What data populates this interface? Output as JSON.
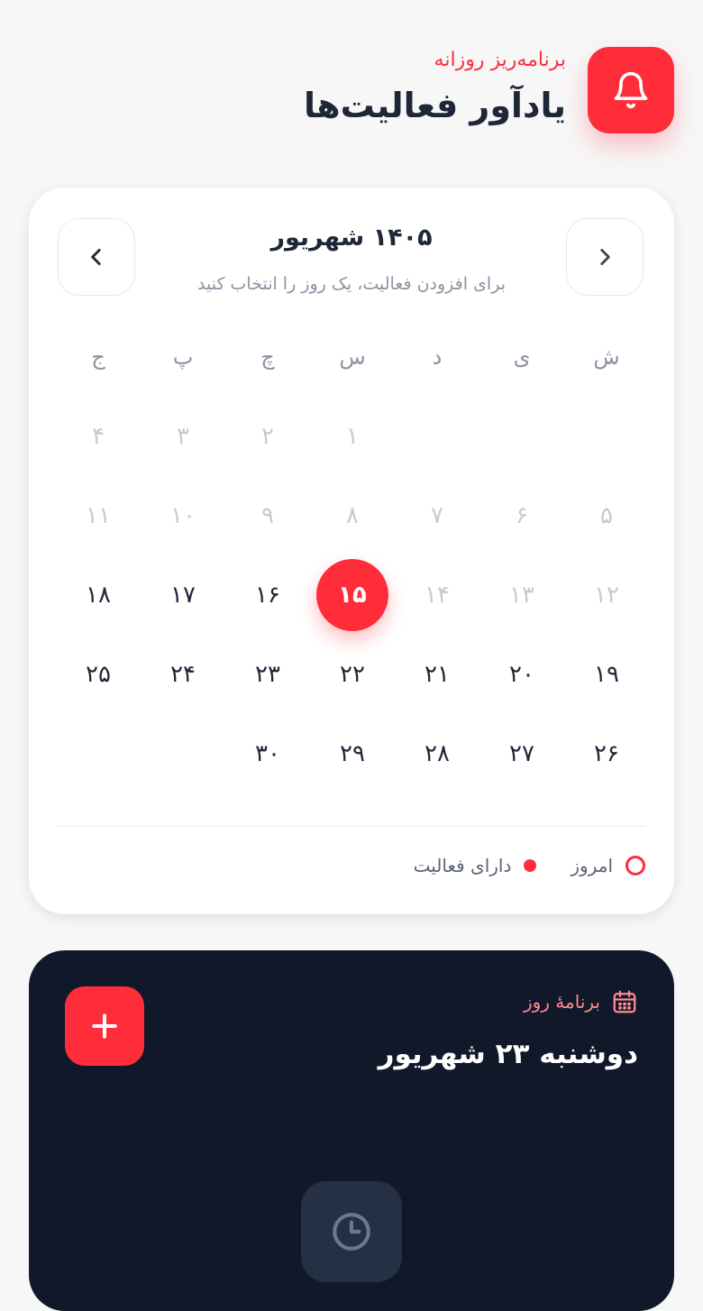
{
  "header": {
    "subtitle": "برنامه‌ریز روزانه",
    "title": "یادآور فعالیت‌ها",
    "icon": "bell-icon"
  },
  "calendar": {
    "month_title": "۱۴۰۵ شهریور",
    "hint": "برای افزودن فعالیت، یک روز را انتخاب کنید",
    "weekdays": [
      "ش",
      "ی",
      "د",
      "س",
      "چ",
      "پ",
      "ج"
    ],
    "days": [
      "۱",
      "۲",
      "۳",
      "۴",
      "۵",
      "۶",
      "۷",
      "۸",
      "۹",
      "۱۰",
      "۱۱",
      "۱۲",
      "۱۳",
      "۱۴",
      "۱۵",
      "۱۶",
      "۱۷",
      "۱۸",
      "۱۹",
      "۲۰",
      "۲۱",
      "۲۲",
      "۲۳",
      "۲۴",
      "۲۵",
      "۲۶",
      "۲۷",
      "۲۸",
      "۲۹",
      "۳۰"
    ],
    "selected_day": "۱۵",
    "legend_today": "امروز",
    "legend_has_activity": "دارای فعالیت",
    "accent": "#ff2d3a"
  },
  "schedule": {
    "label": "برنامهٔ روز",
    "date": "دوشنبه ۲۳ شهریور",
    "background": "#111829"
  }
}
